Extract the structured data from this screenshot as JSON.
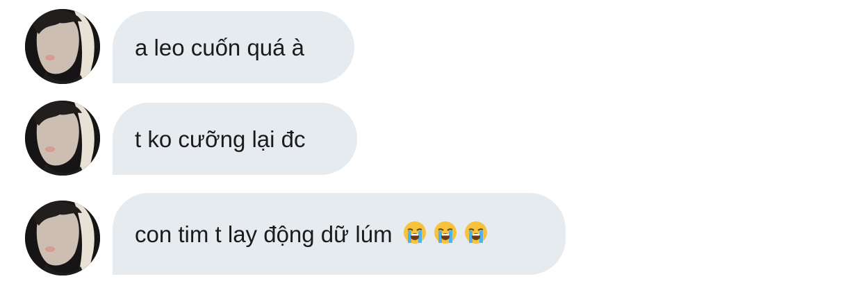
{
  "messages": [
    {
      "text": "a leo cuốn quá à",
      "emojis": []
    },
    {
      "text": "t ko cưỡng lại đc",
      "emojis": []
    },
    {
      "text": "con tim t lay động dữ lúm",
      "emojis": [
        "loudly-crying-face-icon",
        "loudly-crying-face-icon",
        "loudly-crying-face-icon"
      ]
    }
  ],
  "colors": {
    "bubble_background": "#e6ebf0",
    "text": "#1b1b1b",
    "page_background": "#ffffff"
  },
  "icons": {
    "avatar": "profile-photo",
    "emoji": "loudly-crying-face-icon"
  }
}
